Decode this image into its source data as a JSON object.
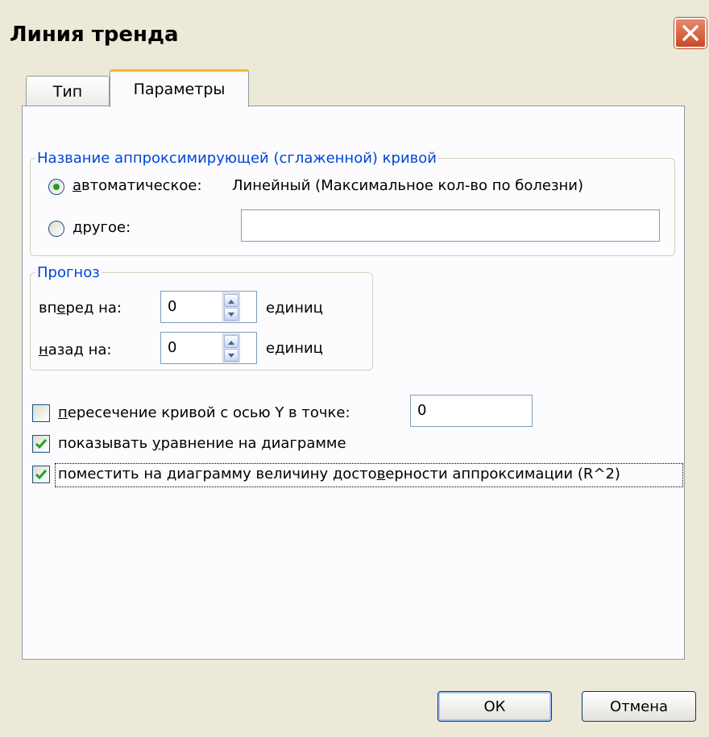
{
  "window": {
    "title": "Линия тренда"
  },
  "tabs": [
    {
      "label": "Тип",
      "active": false
    },
    {
      "label": "Параметры",
      "active": true
    }
  ],
  "name_group": {
    "legend": "Название аппроксимирующей (сглаженной) кривой",
    "auto_option": {
      "label": "автоматическое:",
      "selected": true,
      "value": "Линейный (Максимальное кол-во по болезни)"
    },
    "custom_option": {
      "label": "другое:",
      "selected": false,
      "value": ""
    }
  },
  "forecast_group": {
    "legend": "Прогноз",
    "forward": {
      "label": "вперед на:",
      "value": "0",
      "unit": "единиц"
    },
    "backward": {
      "label": "назад на:",
      "value": "0",
      "unit": "единиц"
    }
  },
  "options": {
    "intercept": {
      "label": "пересечение кривой с осью Y в точке:",
      "checked": false,
      "value": "0"
    },
    "show_equation": {
      "label": "показывать уравнение на диаграмме",
      "checked": true
    },
    "show_r2": {
      "label": "поместить на диаграмму величину достоверности аппроксимации (R^2)",
      "checked": true
    }
  },
  "buttons": {
    "ok": "ОК",
    "cancel": "Отмена"
  },
  "colors": {
    "accent_blue": "#0046d5",
    "check_green": "#21a121",
    "tab_highlight": "#f6b532",
    "close_red": "#c94a26"
  }
}
